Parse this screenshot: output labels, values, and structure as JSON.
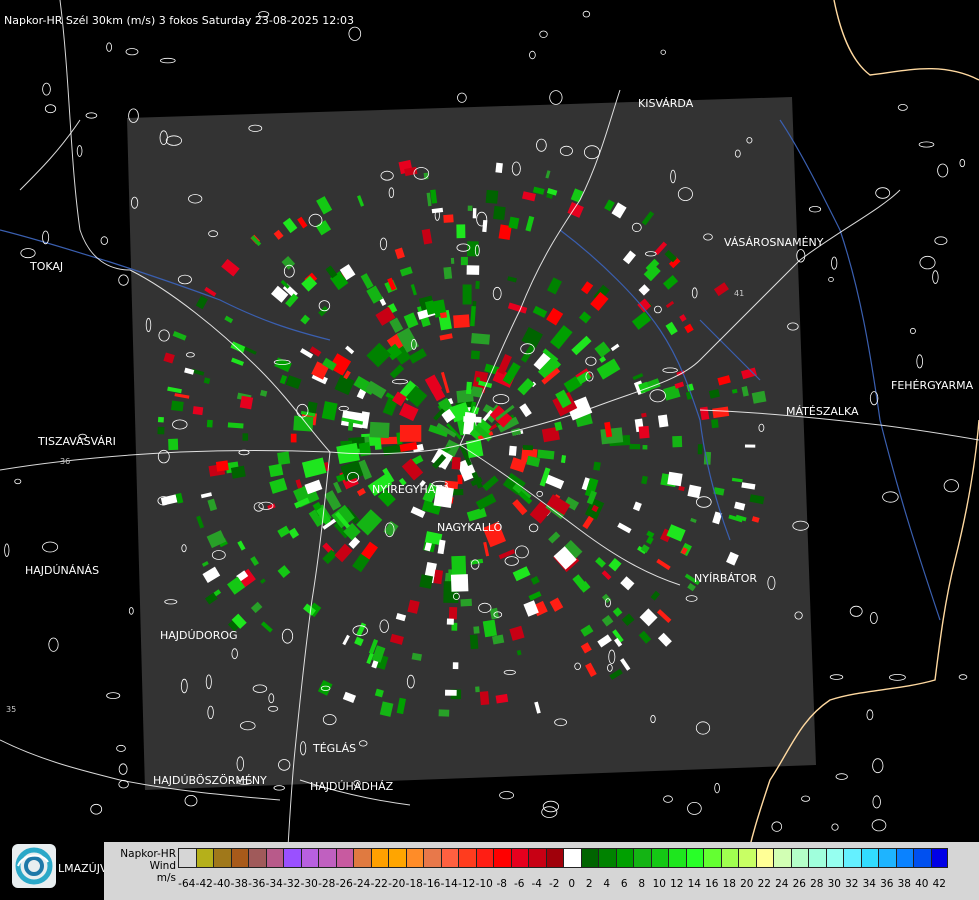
{
  "header": {
    "title": "Napkor-HR Szél 30km (m/s) 3 fokos Saturday 23-08-2025 12:03"
  },
  "map": {
    "cities": [
      {
        "id": "kisvarda",
        "name": "KISVÁRDA"
      },
      {
        "id": "vasarosnameny",
        "name": "VÁSÁROSNAMÉNY"
      },
      {
        "id": "tokaj",
        "name": "TOKAJ"
      },
      {
        "id": "fehergyarmat",
        "name": "FEHÉRGYARMA"
      },
      {
        "id": "mateszalka",
        "name": "MÁTÉSZALKA"
      },
      {
        "id": "tiszavasvari",
        "name": "TISZAVASVÁRI"
      },
      {
        "id": "nyiregyhaza",
        "name": "NYÍREGYHÁZA"
      },
      {
        "id": "nagykallo",
        "name": "NAGYKALLÓ"
      },
      {
        "id": "hajdunanas",
        "name": "HAJDÚNÁNÁS"
      },
      {
        "id": "nyirbator",
        "name": "NYÍRBÁTOR"
      },
      {
        "id": "hajdudorog",
        "name": "HAJDÚDOROG"
      },
      {
        "id": "teglas",
        "name": "TÉGLÁS"
      },
      {
        "id": "hajduboszormeny",
        "name": "HAJDÚBÖSZÖRMÉNY"
      },
      {
        "id": "hajduhadhaz",
        "name": "HAJDÚHADHÁZ"
      },
      {
        "id": "balmazujvaros",
        "name": "LMAZÚJVÁR"
      }
    ],
    "road_numbers": [
      "36",
      "35",
      "41"
    ],
    "colors": {
      "radar_bg": "#333333",
      "border": "#ffd9a0",
      "river": "#3a5fb0",
      "road": "#ffffff"
    }
  },
  "legend": {
    "title_lines": [
      "Napkor-HR",
      "Wind",
      "m/s"
    ],
    "colors": [
      "#d6d6d6",
      "#b5b01a",
      "#a0781a",
      "#a85a1a",
      "#a05a5a",
      "#b85a8a",
      "#9a50ff",
      "#b860e0",
      "#c060c0",
      "#c85aa0",
      "#e07a40",
      "#ffa000",
      "#ffa500",
      "#ff8c28",
      "#e8784a",
      "#ff6040",
      "#ff3c1e",
      "#ff1e14",
      "#ff0000",
      "#e6001e",
      "#c80014",
      "#a0000a",
      "#ffffff",
      "#006400",
      "#008200",
      "#00a000",
      "#14b414",
      "#14c814",
      "#1ee61e",
      "#28ff28",
      "#64ff32",
      "#a0ff50",
      "#c8ff64",
      "#ffff96",
      "#d2ffb4",
      "#b4ffc8",
      "#a0ffdc",
      "#96fff0",
      "#64f0ff",
      "#32dcff",
      "#1eb4ff",
      "#0a82ff",
      "#0050f0",
      "#0000e6"
    ],
    "ticks": [
      "-64",
      "-42",
      "-40",
      "-38",
      "-36",
      "-34",
      "-32",
      "-30",
      "-28",
      "-26",
      "-24",
      "-22",
      "-20",
      "-18",
      "-16",
      "-14",
      "-12",
      "-10",
      "-8",
      "-6",
      "-4",
      "-2",
      "0",
      "2",
      "4",
      "6",
      "8",
      "10",
      "12",
      "14",
      "16",
      "18",
      "20",
      "22",
      "24",
      "26",
      "28",
      "30",
      "32",
      "34",
      "36",
      "38",
      "40",
      "42"
    ]
  }
}
